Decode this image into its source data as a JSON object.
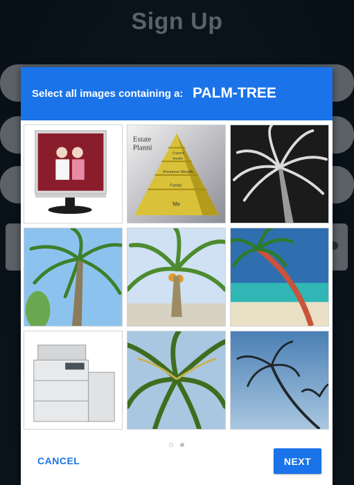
{
  "page": {
    "title": "Sign Up"
  },
  "captcha": {
    "prompt": "Select all images containing a:",
    "target": "PALM-TREE",
    "tiles": [
      {
        "subject": "monitor"
      },
      {
        "subject": "pyramid-chart",
        "labels": [
          "Estate",
          "Planni",
          "Expand",
          "Wealth",
          "Preserve Wealth",
          "Family",
          "Me"
        ]
      },
      {
        "subject": "palm-tree"
      },
      {
        "subject": "palm-tree"
      },
      {
        "subject": "palm-tree"
      },
      {
        "subject": "palm-tree"
      },
      {
        "subject": "copier"
      },
      {
        "subject": "palm-tree"
      },
      {
        "subject": "palm-tree"
      }
    ],
    "pages": 2,
    "current_page": 2,
    "cancel_label": "CANCEL",
    "next_label": "NEXT"
  },
  "colors": {
    "accent": "#1a73e8",
    "background": "#0b1117",
    "field": "#5c6167"
  }
}
